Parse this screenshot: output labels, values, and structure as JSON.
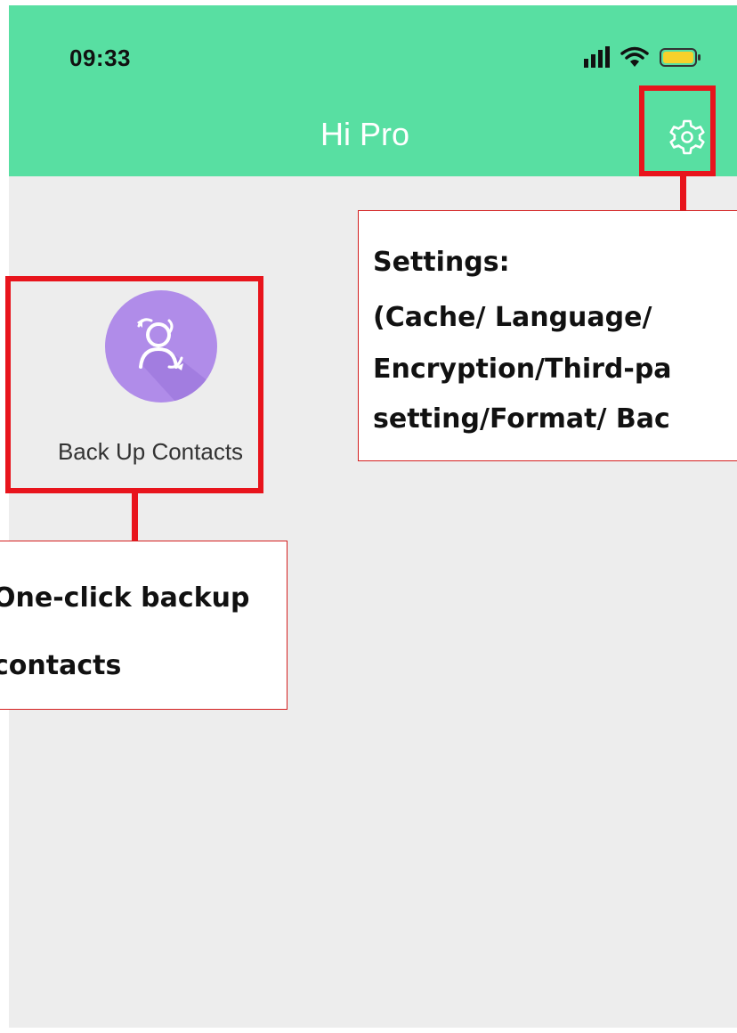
{
  "status_bar": {
    "time": "09:33",
    "icons": [
      "signal-icon",
      "wifi-icon",
      "battery-icon"
    ]
  },
  "header": {
    "title": "Hi Pro",
    "settings_icon": "gear-icon"
  },
  "tiles": [
    {
      "label": "Back Up Contacts",
      "icon": "contacts-sync-icon",
      "color": "#b08ce9"
    }
  ],
  "annotations": {
    "settings": {
      "lines": [
        "Settings:",
        "(Cache/   Language/",
        "Encryption/Third-pa",
        "setting/Format/ Bac"
      ]
    },
    "backup": {
      "lines": [
        "One-click backup",
        "contacts"
      ]
    }
  },
  "colors": {
    "header_bg": "#58dfa2",
    "body_bg": "#ededed",
    "highlight": "#e8141c",
    "tile_icon_bg": "#b08ce9"
  }
}
